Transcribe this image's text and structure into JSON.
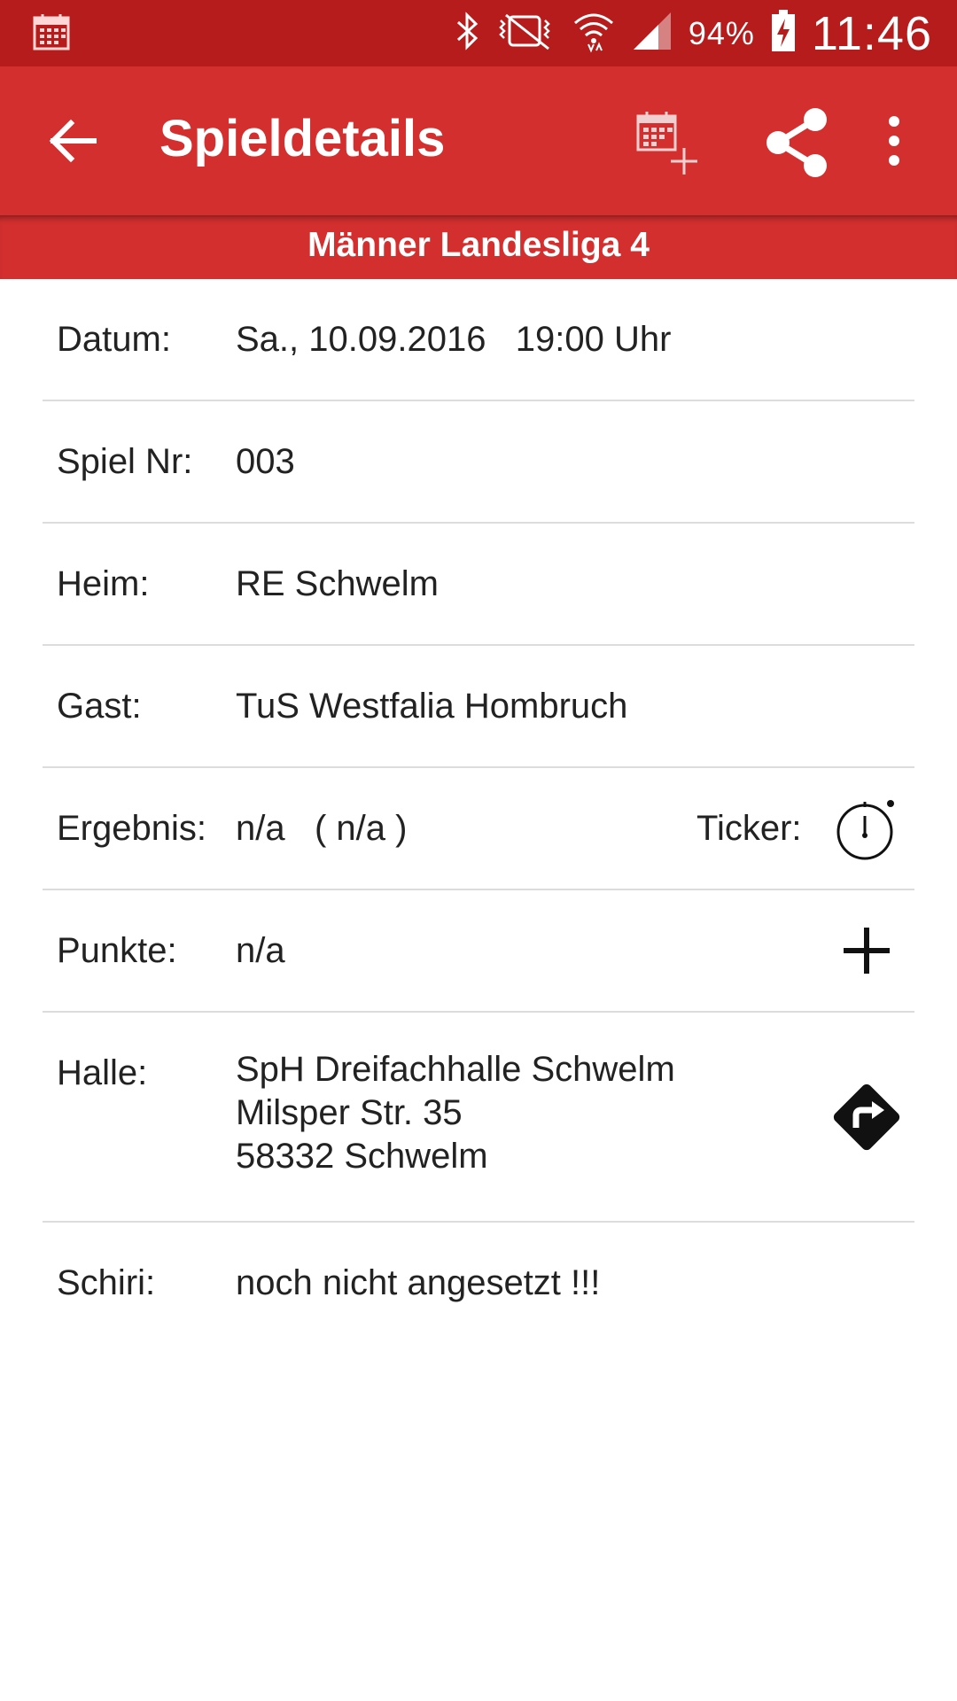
{
  "status_bar": {
    "battery_percent": "94%",
    "time": "11:46",
    "icons": [
      "calendar-notification-icon",
      "bluetooth-icon",
      "vibrate-mute-icon",
      "wifi-icon",
      "cell-signal-icon",
      "battery-charging-icon"
    ]
  },
  "app_bar": {
    "title": "Spieldetails",
    "icons": [
      "back-arrow-icon",
      "calendar-add-icon",
      "share-icon",
      "more-vert-icon"
    ]
  },
  "league": {
    "title": "Männer Landesliga 4"
  },
  "details": {
    "datum": {
      "label": "Datum:",
      "value": "Sa., 10.09.2016   19:00 Uhr"
    },
    "spiel_nr": {
      "label": "Spiel Nr:",
      "value": "003"
    },
    "heim": {
      "label": "Heim:",
      "value": "RE Schwelm"
    },
    "gast": {
      "label": "Gast:",
      "value": "TuS Westfalia Hombruch"
    },
    "ergebnis": {
      "label": "Ergebnis:",
      "value": "n/a   ( n/a )",
      "ticker_label": "Ticker:"
    },
    "punkte": {
      "label": "Punkte:",
      "value": "n/a"
    },
    "halle": {
      "label": "Halle:",
      "line1": "SpH Dreifachhalle Schwelm",
      "line2": "Milsper Str. 35",
      "line3": "58332 Schwelm"
    },
    "schiri": {
      "label": "Schiri:",
      "value": "noch nicht angesetzt !!!"
    }
  },
  "colors": {
    "status_bar": "#b71c1c",
    "app_bar": "#d32f2f",
    "divider": "#dcdcdc"
  }
}
